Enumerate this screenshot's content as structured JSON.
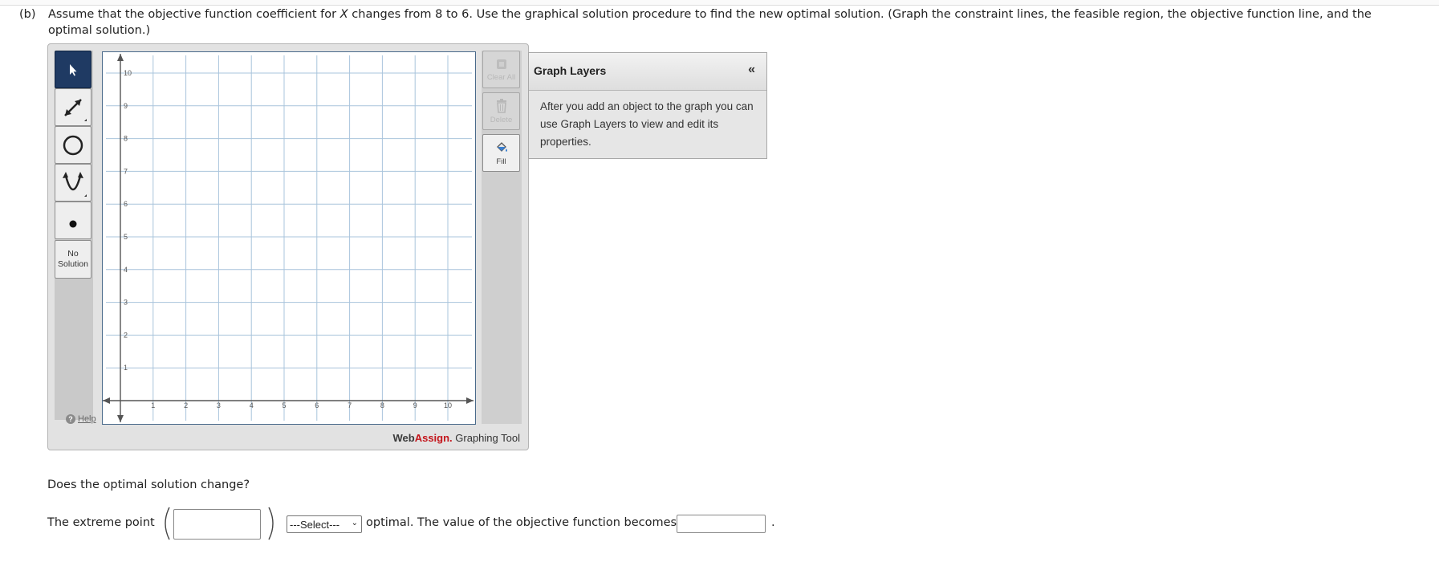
{
  "question": {
    "label": "(b)",
    "text_pre": "Assume that the objective function coefficient for ",
    "variable": "X",
    "text_post": " changes from 8 to 6. Use the graphical solution procedure to find the new optimal solution. (Graph the constraint lines, the feasible region, the objective function line, and the optimal solution.)"
  },
  "toolbar": {
    "tools": [
      {
        "name": "select-tool",
        "icon": "arrow-pointer-icon",
        "active": true
      },
      {
        "name": "line-tool",
        "icon": "line-segment-icon"
      },
      {
        "name": "circle-tool",
        "icon": "circle-icon"
      },
      {
        "name": "parabola-tool",
        "icon": "parabola-icon"
      },
      {
        "name": "point-tool",
        "icon": "point-icon"
      }
    ],
    "no_solution_line1": "No",
    "no_solution_line2": "Solution",
    "help_label": "Help"
  },
  "graph": {
    "x_ticks": [
      "1",
      "2",
      "3",
      "4",
      "5",
      "6",
      "7",
      "8",
      "9",
      "10"
    ],
    "y_ticks": [
      "1",
      "2",
      "3",
      "4",
      "5",
      "6",
      "7",
      "8",
      "9",
      "10"
    ],
    "xlim": [
      0,
      10.6
    ],
    "ylim": [
      0,
      10.6
    ]
  },
  "side_buttons": {
    "clear_all": "Clear All",
    "delete": "Delete",
    "fill": "Fill"
  },
  "brand": {
    "web": "Web",
    "assign": "Assign.",
    "tool": " Graphing Tool"
  },
  "layers": {
    "title": "Graph Layers",
    "collapse": "«",
    "body": "After you add an object to the graph you can use Graph Layers to view and edit its properties."
  },
  "followup": {
    "question": "Does the optimal solution change?",
    "extreme_point_label": "The extreme point",
    "point_value": "",
    "select_value": "---Select---",
    "middle_text": "optimal. The value of the objective function becomes",
    "objective_value": "",
    "end_punct": "."
  }
}
